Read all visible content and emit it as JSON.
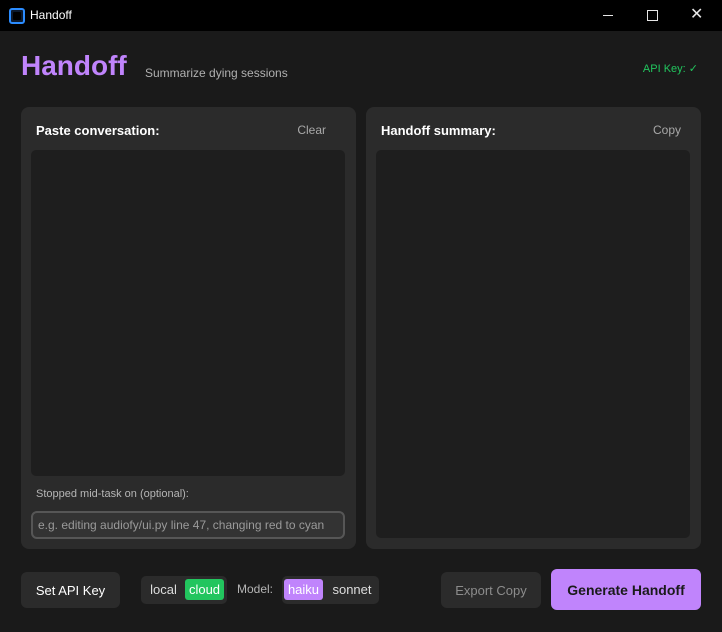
{
  "window": {
    "title": "Handoff"
  },
  "header": {
    "brand": "Handoff",
    "tagline": "Summarize dying sessions",
    "api_status": "API Key: ✓"
  },
  "left_panel": {
    "title": "Paste conversation:",
    "action": "Clear",
    "conversation_value": "",
    "stopped_label": "Stopped mid-task on (optional):",
    "stopped_placeholder": "e.g. editing audiofy/ui.py line 47, changing red to cyan",
    "stopped_value": ""
  },
  "right_panel": {
    "title": "Handoff summary:",
    "action": "Copy",
    "summary_value": ""
  },
  "bottom": {
    "set_api_key": "Set API Key",
    "mode_options": [
      "local",
      "cloud"
    ],
    "mode_selected": "cloud",
    "model_label": "Model:",
    "model_options": [
      "haiku",
      "sonnet"
    ],
    "model_selected": "haiku",
    "export_copy": "Export Copy",
    "generate": "Generate Handoff"
  },
  "colors": {
    "accent_purple": "#c084fc",
    "accent_green": "#22c55e",
    "panel_bg": "#2b2b2b",
    "window_bg": "#1a1a1a"
  },
  "icons": {
    "app": "app-window-icon",
    "minimize": "minimize-icon",
    "maximize": "maximize-icon",
    "close": "close-icon"
  }
}
